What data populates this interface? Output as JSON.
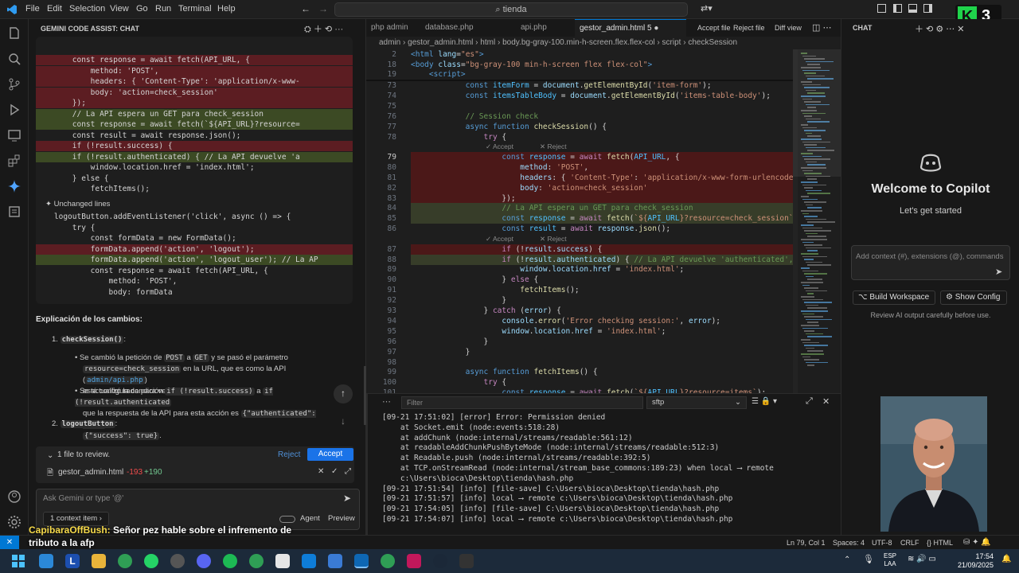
{
  "titlebar": {
    "menus": [
      "File",
      "Edit",
      "Selection",
      "View",
      "Go",
      "Run",
      "Terminal",
      "Help"
    ],
    "search": "tienda",
    "accent": "#0078d4"
  },
  "gemini": {
    "header": "GEMINI CODE ASSIST: CHAT",
    "diff_lines": [
      {
        "type": "del",
        "text": "        const response = await fetch(API_URL, {"
      },
      {
        "type": "del",
        "text": "            method: 'POST',"
      },
      {
        "type": "del",
        "text": "            headers: { 'Content-Type': 'application/x-www-"
      },
      {
        "type": "del",
        "text": "            body: 'action=check_session'"
      },
      {
        "type": "del",
        "text": "        });"
      },
      {
        "type": "add",
        "text": "        // La API espera un GET para check_session"
      },
      {
        "type": "add",
        "text": "        const response = await fetch(`${API_URL}?resource="
      },
      {
        "type": "unch",
        "text": "        const result = await response.json();"
      },
      {
        "type": "del",
        "text": "        if (!result.success) {"
      },
      {
        "type": "add",
        "text": "        if (!result.authenticated) { // La API devuelve 'a"
      },
      {
        "type": "unch",
        "text": "            window.location.href = 'index.html';"
      },
      {
        "type": "unch",
        "text": "        } else {"
      },
      {
        "type": "unch",
        "text": "            fetchItems();"
      }
    ],
    "unchanged_label": "Unchanged lines",
    "diff_lines_2": [
      {
        "type": "unch",
        "text": "    logoutButton.addEventListener('click', async () => {"
      },
      {
        "type": "unch",
        "text": "        try {"
      },
      {
        "type": "unch",
        "text": "            const formData = new FormData();"
      },
      {
        "type": "del",
        "text": "            formData.append('action', 'logout');"
      },
      {
        "type": "add",
        "text": "            formData.append('action', 'logout_user'); // La AP"
      },
      {
        "type": "unch",
        "text": "            const response = await fetch(API_URL, {"
      },
      {
        "type": "unch",
        "text": "                method: 'POST',"
      },
      {
        "type": "unch",
        "text": "                body: formData"
      }
    ],
    "explanation_title": "Explicación de los cambios:",
    "item1_title": "checkSession()",
    "item1_colon": ":",
    "bullet1_a": "Se cambió la petición de",
    "bullet1_post": "POST",
    "bullet1_b": "a",
    "bullet1_get": "GET",
    "bullet1_c": "y se pasó el parámetro",
    "bullet1_param": "resource=check_session",
    "bullet1_d": "en la URL, que es como la API (",
    "bullet1_link": "admin/api.php",
    "bullet1_e": ")",
    "bullet1_f": "está configurada para verificar la sesión.",
    "bullet2_a": "Se actualizó la condición",
    "bullet2_c1": "if (!result.success)",
    "bullet2_b": "a",
    "bullet2_c2": "if (!result.authenticated",
    "bullet2_d": "que la respuesta de la API para esta acción es",
    "bullet2_c3": "{\"authenticated\": true}",
    "bullet2_e": "y",
    "bullet2_c4": "{\"success\": true}",
    "bullet2_f": ".",
    "item2_title": "logoutButton",
    "item2_colon": ":",
    "review_text": "1 file to review.",
    "reject_label": "Reject",
    "accept_label": "Accept",
    "file_name": "gestor_admin.html",
    "file_del": "-193",
    "file_add": "+190",
    "ask_placeholder": "Ask Gemini or type '@'",
    "context_label": "1 context item",
    "agent_label": "Agent",
    "preview_label": "Preview"
  },
  "editor": {
    "tabs": [
      "php admin",
      "database.php",
      "api.php",
      "gestor_admin.html 5"
    ],
    "accept_file": "Accept file",
    "reject_file": "Reject file",
    "diff_view": "Diff view",
    "breadcrumb": [
      "admin",
      "gestor_admin.html",
      "html",
      "body.bg-gray-100.min-h-screen.flex.flex-col",
      "script",
      "checkSession"
    ],
    "sticky": [
      {
        "n": "2",
        "html": "<span class=\"kw\">&lt;html</span> <span class=\"var\">lang</span>=<span class=\"str\">\"es\"</span><span class=\"kw\">&gt;</span>"
      },
      {
        "n": "18",
        "html": "<span class=\"kw\">&lt;body</span> <span class=\"var\">class</span>=<span class=\"str\">\"bg-gray-100 min-h-screen flex flex-col\"</span><span class=\"kw\">&gt;</span>"
      },
      {
        "n": "19",
        "html": "    <span class=\"kw\">&lt;script&gt;</span>"
      }
    ],
    "accept_hint": "✓ Accept",
    "reject_hint": "✕ Reject"
  },
  "terminal": {
    "filter_placeholder": "Filter",
    "channel": "sftp",
    "lines": [
      "[09-21 17:51:02] [error] Error: Permission denied",
      "    at Socket.emit (node:events:518:28)",
      "    at addChunk (node:internal/streams/readable:561:12)",
      "    at readableAddChunkPushByteMode (node:internal/streams/readable:512:3)",
      "    at Readable.push (node:internal/streams/readable:392:5)",
      "    at TCP.onStreamRead (node:internal/stream_base_commons:189:23) when local ⟶ remote",
      "    c:\\Users\\bioca\\Desktop\\tienda\\hash.php",
      "[09-21 17:51:54] [info] [file-save] C:\\Users\\bioca\\Desktop\\tienda\\hash.php",
      "[09-21 17:51:57] [info] local ⟶ remote c:\\Users\\bioca\\Desktop\\tienda\\hash.php",
      "[09-21 17:54:05] [info] [file-save] C:\\Users\\bioca\\Desktop\\tienda\\hash.php",
      "[09-21 17:54:07] [info] local ⟶ remote c:\\Users\\bioca\\Desktop\\tienda\\hash.php"
    ]
  },
  "chat": {
    "header": "CHAT",
    "welcome": "Welcome to Copilot",
    "sub": "Let's get started",
    "input_placeholder": "Add context (#), extensions (@), commands",
    "build_workspace": "Build Workspace",
    "show_config": "Show Config",
    "review_note": "Review AI output carefully before use."
  },
  "statusbar": {
    "position": "Ln 79, Col 1",
    "spaces": "Spaces: 4",
    "encoding": "UTF-8",
    "eol": "CRLF",
    "language": "HTML"
  },
  "overlay": {
    "user": "CapibaraOffBush:",
    "message_1": "Señor pez hable sobre el infremento de",
    "message_2": "tributo a la afp"
  },
  "taskbar": {
    "lang": "ESP",
    "lang2": "LAA",
    "time": "17:54",
    "date": "21/09/2025"
  },
  "badge": "3"
}
